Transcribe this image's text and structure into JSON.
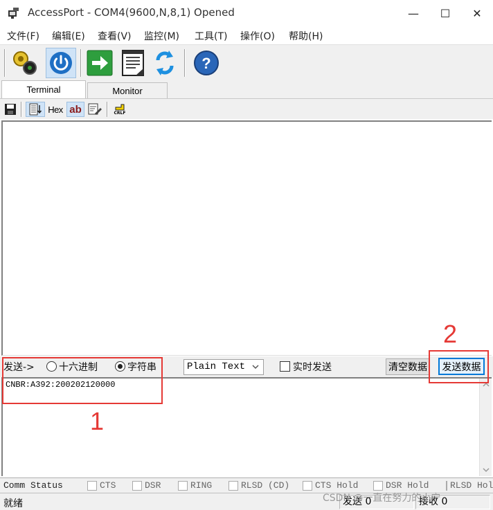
{
  "window": {
    "title": "AccessPort - COM4(9600,N,8,1) Opened",
    "minimize": "—",
    "maximize": "☐",
    "close": "✕"
  },
  "menu": [
    "文件(F)",
    "编辑(E)",
    "查看(V)",
    "监控(M)",
    "工具(T)",
    "操作(O)",
    "帮助(H)"
  ],
  "toolbar": {
    "icons": [
      "settings-gears-icon",
      "power-icon",
      "arrow-right-icon",
      "notepad-icon",
      "refresh-icon",
      "help-icon"
    ]
  },
  "tabs": [
    "Terminal",
    "Monitor"
  ],
  "subtoolbar": {
    "hex_label": "Hex",
    "ab_label": "ab",
    "crlf_label": "CRLF"
  },
  "send": {
    "label": "发送->",
    "hex_option": "十六进制",
    "string_option": "字符串",
    "selected": "string",
    "format": "Plain Text",
    "realtime_label": "实时发送",
    "clear_button": "清空数据",
    "send_button": "发送数据",
    "input_text": "CNBR:A392:200202120000"
  },
  "comm_status": {
    "label": "Comm Status",
    "signals": [
      "CTS",
      "DSR",
      "RING",
      "RLSD (CD)",
      "CTS Hold",
      "DSR Hold",
      "RLSD Hold"
    ]
  },
  "statusbar": {
    "ready": "就绪",
    "sent": "发送 0",
    "received": "接收 0"
  },
  "annotations": {
    "box1_number": "1",
    "box2_number": "2",
    "color": "#e53935"
  },
  "watermark": "CSDN @一直在努力的小宁"
}
